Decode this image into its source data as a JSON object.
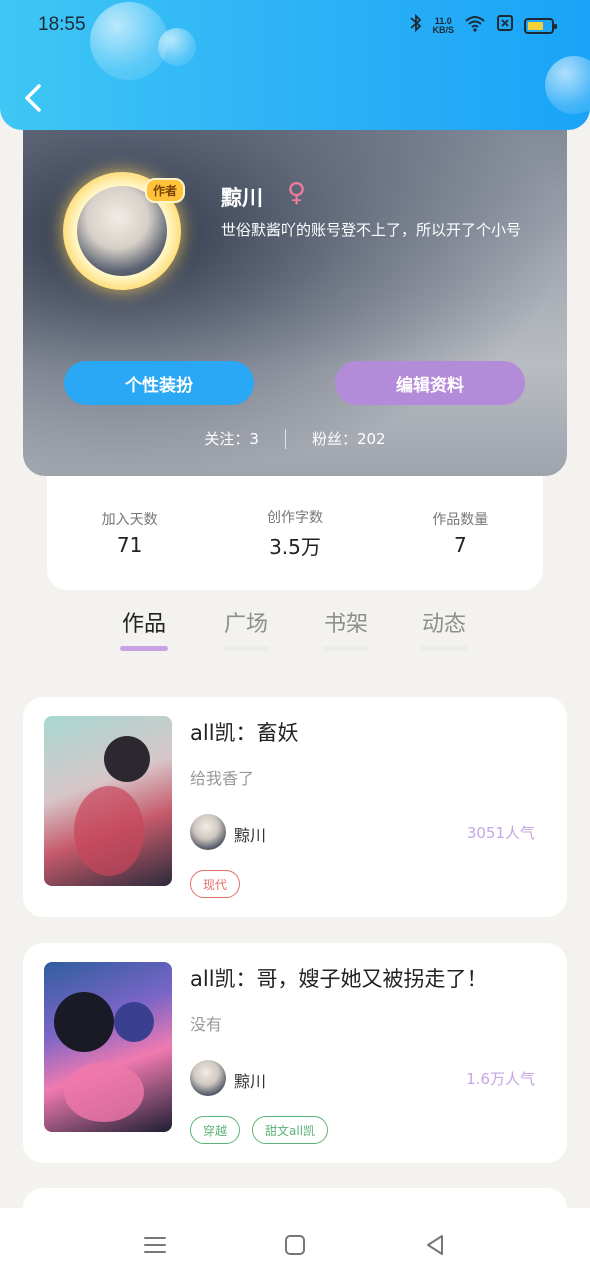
{
  "status": {
    "time": "18:55",
    "network_speed": "11.0",
    "network_unit": "KB/S"
  },
  "profile": {
    "avatar_badge": "作者",
    "username": "黥川",
    "gender_symbol": "♀",
    "bio": "世俗默酱吖的账号登不上了，所以开了个小号",
    "decorate_label": "个性装扮",
    "edit_label": "编辑资料",
    "following": "关注：3",
    "followers": "粉丝：202"
  },
  "stats": [
    {
      "label": "加入天数",
      "value": "71"
    },
    {
      "label": "创作字数",
      "value": "3.5万"
    },
    {
      "label": "作品数量",
      "value": "7"
    }
  ],
  "tabs": [
    "作品",
    "广场",
    "书架",
    "动态"
  ],
  "works": [
    {
      "title": "all凯：畜妖",
      "desc": "给我香了",
      "author": "黥川",
      "popularity": "3051人气",
      "tags": [
        "现代"
      ]
    },
    {
      "title": "all凯：哥，嫂子她又被拐走了！",
      "desc": "没有",
      "author": "黥川",
      "popularity": "1.6万人气",
      "tags": [
        "穿越",
        "甜文all凯"
      ]
    }
  ],
  "colors": {
    "header": "#2fb4f7",
    "accent_blue": "#2aa7f5",
    "accent_purple": "#b48bd8",
    "popularity": "#c6a5e2"
  }
}
